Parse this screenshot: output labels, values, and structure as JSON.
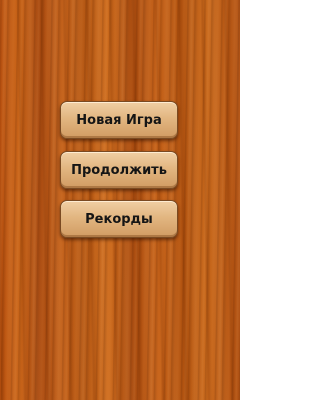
{
  "menu": {
    "new_game": "Новая Игра",
    "continue": "Продолжить",
    "records": "Рекорды"
  },
  "theme": {
    "background": "wood-texture",
    "button_color": "#e2b681",
    "text_color": "#151515"
  }
}
